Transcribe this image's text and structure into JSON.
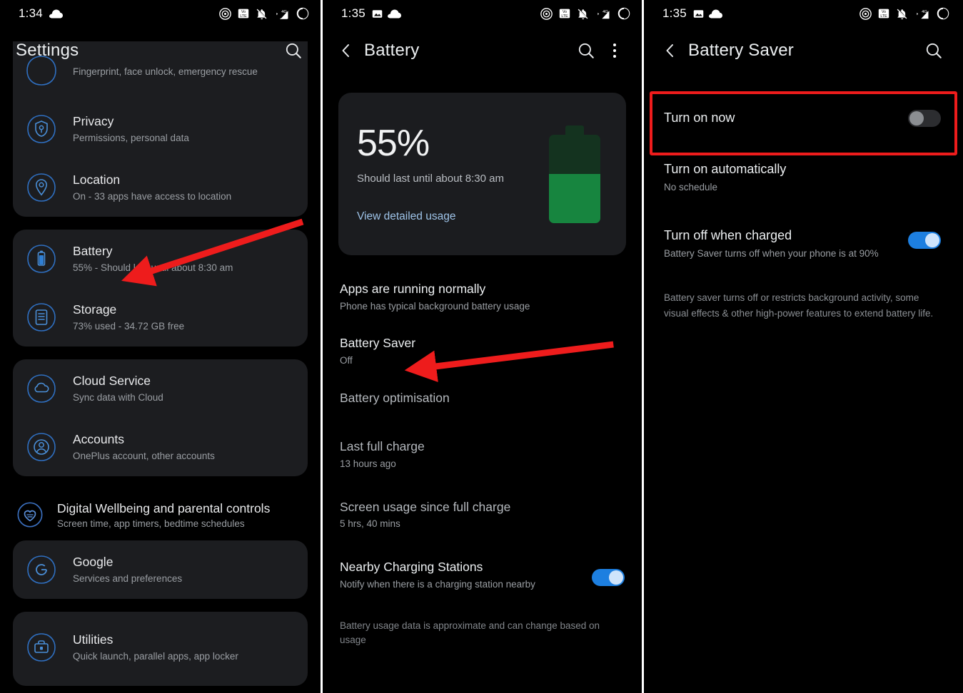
{
  "panel1": {
    "status": {
      "time": "1:34",
      "icons": [
        "cloud-icon",
        "cast-icon",
        "volte-icon",
        "mute-bell-icon",
        "signal-4g-icon",
        "battery-circle-icon"
      ]
    },
    "appbar": {
      "title": "Settings",
      "search_icon": "search-icon"
    },
    "cards": [
      {
        "id": "security-card",
        "clipped_top": true,
        "rows": [
          {
            "icon": "fingerprint-icon",
            "title": "",
            "subtitle": "Fingerprint, face unlock, emergency rescue"
          },
          {
            "icon": "privacy-shield-icon",
            "title": "Privacy",
            "subtitle": "Permissions, personal data"
          },
          {
            "icon": "location-pin-icon",
            "title": "Location",
            "subtitle": "On - 33 apps have access to location"
          }
        ]
      },
      {
        "id": "battery-storage-card",
        "clipped_top": false,
        "rows": [
          {
            "icon": "battery-icon",
            "title": "Battery",
            "subtitle": "55% - Should last until about 8:30 am"
          },
          {
            "icon": "storage-icon",
            "title": "Storage",
            "subtitle": "73% used - 34.72 GB free"
          }
        ]
      },
      {
        "id": "cloud-accounts-card",
        "clipped_top": false,
        "rows": [
          {
            "icon": "cloud-sync-icon",
            "title": "Cloud Service",
            "subtitle": "Sync data with Cloud"
          },
          {
            "icon": "account-icon",
            "title": "Accounts",
            "subtitle": "OnePlus account, other accounts"
          }
        ]
      }
    ],
    "wellbeing": {
      "icon": "heart-wellbeing-icon",
      "title": "Digital Wellbeing and parental controls",
      "subtitle": "Screen time, app timers, bedtime schedules"
    },
    "cards2": [
      {
        "id": "google-card",
        "rows": [
          {
            "icon": "google-g-icon",
            "title": "Google",
            "subtitle": "Services and preferences"
          }
        ]
      },
      {
        "id": "utilities-card",
        "rows": [
          {
            "icon": "toolbox-icon",
            "title": "Utilities",
            "subtitle": "Quick launch, parallel apps, app locker"
          }
        ]
      }
    ]
  },
  "panel2": {
    "status": {
      "time": "1:35",
      "icons": [
        "image-icon",
        "cloud-icon",
        "cast-icon",
        "volte-icon",
        "mute-bell-icon",
        "signal-4g-icon",
        "battery-circle-icon"
      ]
    },
    "appbar": {
      "back_icon": "back-arrow-icon",
      "title": "Battery",
      "search_icon": "search-icon",
      "overflow_icon": "kebab-menu-icon"
    },
    "hero": {
      "percent": "55%",
      "subtitle": "Should last until about 8:30 am",
      "link": "View detailed usage",
      "battery_fill_percent": 55,
      "fill_color": "#17853f",
      "track_color": "#14331f"
    },
    "items": [
      {
        "title": "Apps are running normally",
        "subtitle": "Phone has typical background battery usage",
        "dim": false,
        "toggle": null
      },
      {
        "title": "Battery Saver",
        "subtitle": "Off",
        "dim": false,
        "toggle": null
      },
      {
        "title": "Battery optimisation",
        "subtitle": "",
        "dim": true,
        "toggle": null
      },
      {
        "title": "Last full charge",
        "subtitle": "13 hours ago",
        "dim": true,
        "toggle": null
      },
      {
        "title": "Screen usage since full charge",
        "subtitle": "5 hrs, 40 mins",
        "dim": true,
        "toggle": null
      },
      {
        "title": "Nearby Charging Stations",
        "subtitle": "Notify when there is a charging station nearby",
        "dim": false,
        "toggle": "on"
      }
    ],
    "footer": "Battery usage data is approximate and can change based on usage"
  },
  "panel3": {
    "status": {
      "time": "1:35",
      "icons": [
        "image-icon",
        "cloud-icon",
        "cast-icon",
        "volte-icon",
        "mute-bell-icon",
        "signal-4g-icon",
        "battery-circle-icon"
      ]
    },
    "appbar": {
      "back_icon": "back-arrow-icon",
      "title": "Battery Saver",
      "search_icon": "search-icon"
    },
    "items": [
      {
        "title": "Turn on now",
        "subtitle": "",
        "toggle": "off",
        "highlighted": true
      },
      {
        "title": "Turn on automatically",
        "subtitle": "No schedule",
        "toggle": null,
        "highlighted": false
      },
      {
        "title": "Turn off when charged",
        "subtitle": "Battery Saver turns off when your phone is at 90%",
        "toggle": "on",
        "highlighted": false
      }
    ],
    "footer": "Battery saver turns off or restricts background activity, some visual effects & other high-power features to extend battery life.",
    "highlight_color": "#ee1c1c"
  },
  "annotations": {
    "arrow_color": "#ee1c1c",
    "arrow1_label": "arrow-pointing-to-battery",
    "arrow2_label": "arrow-pointing-to-battery-saver"
  }
}
